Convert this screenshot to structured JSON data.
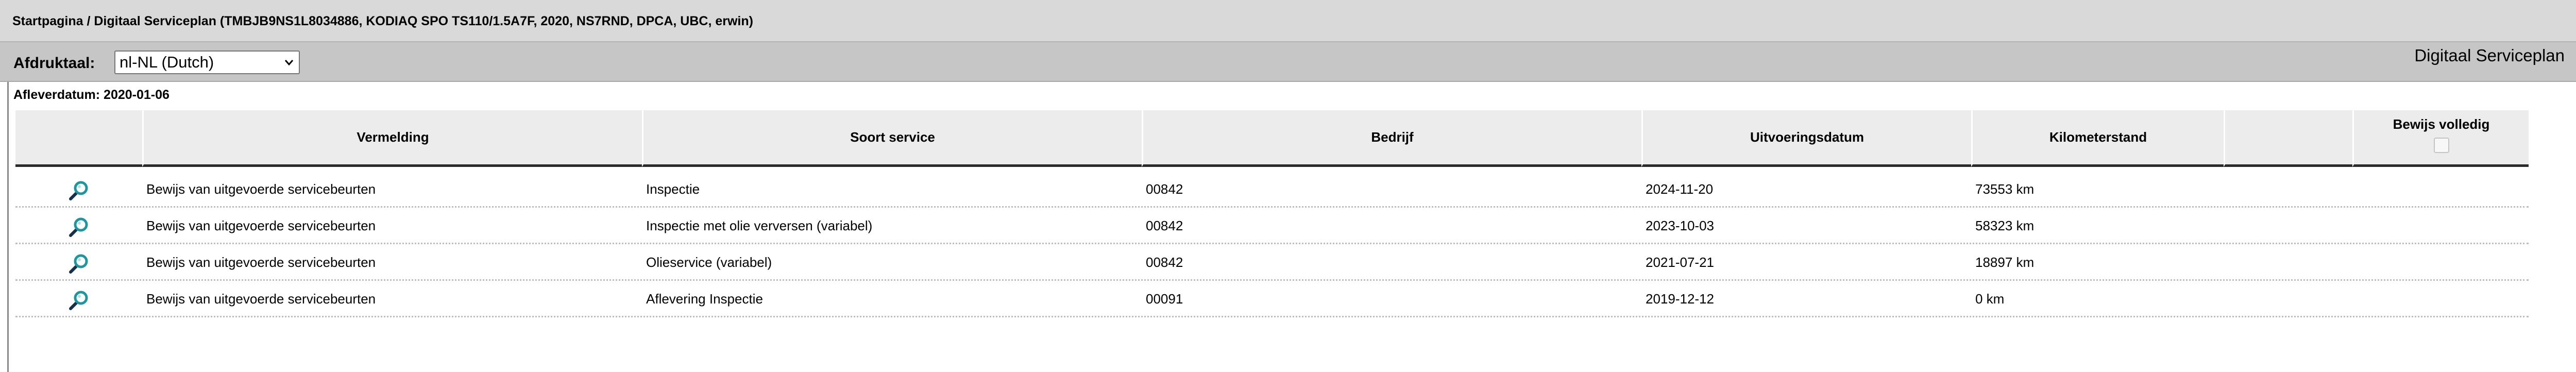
{
  "breadcrumb": "Startpagina / Digitaal Serviceplan (TMBJB9NS1L8034886, KODIAQ SPO TS110/1.5A7F, 2020, NS7RND, DPCA, UBC, erwin)",
  "toolbar": {
    "language_label": "Afdruktaal:",
    "language_selected": "nl-NL (Dutch)",
    "page_heading": "Digitaal Serviceplan"
  },
  "delivery_date": "Afleverdatum: 2020-01-06",
  "table": {
    "columns": [
      "",
      "Vermelding",
      "Soort service",
      "Bedrijf",
      "Uitvoeringsdatum",
      "Kilometerstand",
      "",
      "Bewijs volledig"
    ],
    "rows": [
      {
        "entry": "Bewijs van uitgevoerde servicebeurten",
        "service_type": "Inspectie",
        "company": "00842",
        "date": "2024-11-20",
        "mileage": "73553 km"
      },
      {
        "entry": "Bewijs van uitgevoerde servicebeurten",
        "service_type": "Inspectie met olie verversen (variabel)",
        "company": "00842",
        "date": "2023-10-03",
        "mileage": "58323 km"
      },
      {
        "entry": "Bewijs van uitgevoerde servicebeurten",
        "service_type": "Olieservice (variabel)",
        "company": "00842",
        "date": "2021-07-21",
        "mileage": "18897 km"
      },
      {
        "entry": "Bewijs van uitgevoerde servicebeurten",
        "service_type": "Aflevering Inspectie",
        "company": "00091",
        "date": "2019-12-12",
        "mileage": "0 km"
      }
    ]
  },
  "colors": {
    "breadcrumb_bg": "#d9d9d9",
    "toolbar_bg": "#c6c6c6",
    "header_cell_bg": "#ececec",
    "magnifier_lens": "#1e96a0"
  },
  "icons": {
    "row_action": "magnifier-icon",
    "select_caret": "chevron-down-icon"
  }
}
